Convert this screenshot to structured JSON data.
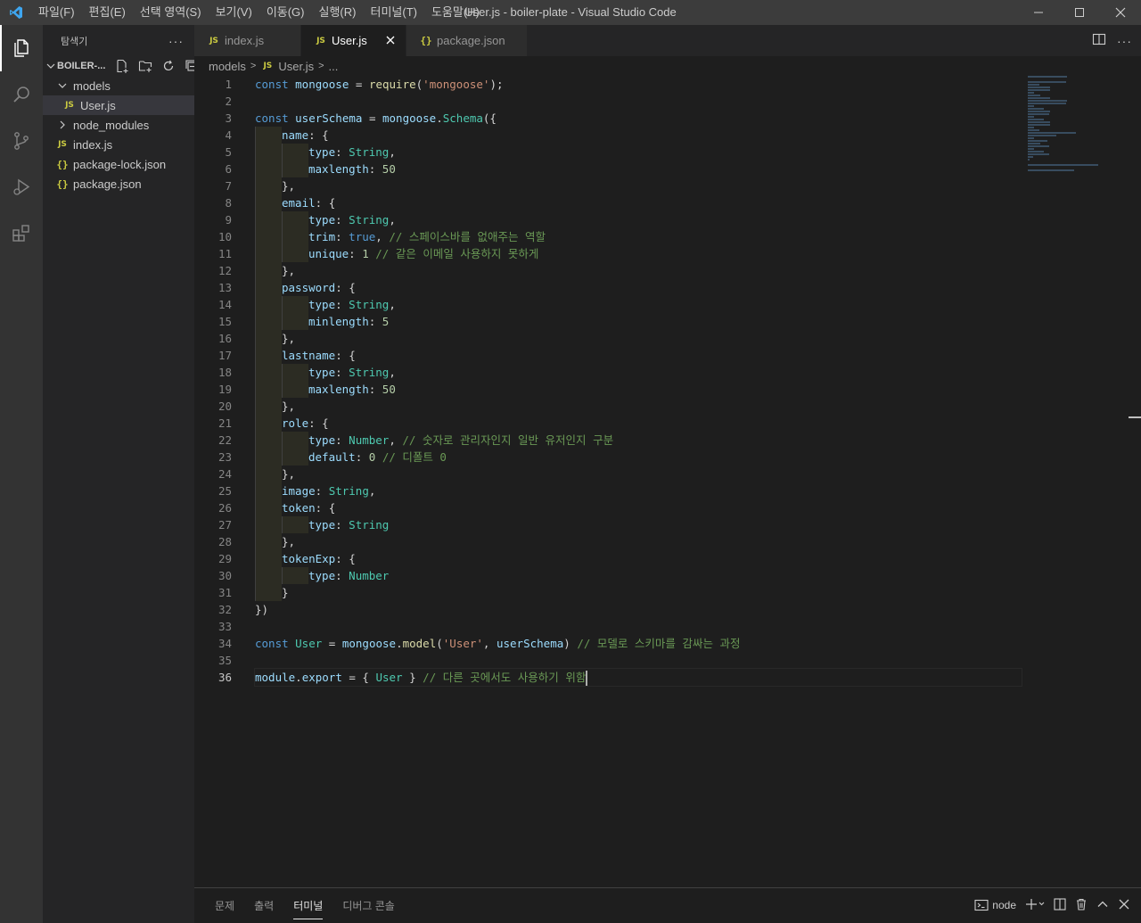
{
  "window": {
    "title": "User.js - boiler-plate - Visual Studio Code",
    "menu": [
      "파일(F)",
      "편집(E)",
      "선택 영역(S)",
      "보기(V)",
      "이동(G)",
      "실행(R)",
      "터미널(T)",
      "도움말(H)"
    ]
  },
  "sidebar": {
    "title": "탐색기",
    "more": "···",
    "folder": "BOILER-...",
    "tree": [
      {
        "label": "models",
        "kind": "folder-open",
        "depth": 1
      },
      {
        "label": "User.js",
        "kind": "js",
        "depth": 2,
        "selected": true
      },
      {
        "label": "node_modules",
        "kind": "folder-closed",
        "depth": 1
      },
      {
        "label": "index.js",
        "kind": "js",
        "depth": 1
      },
      {
        "label": "package-lock.json",
        "kind": "json",
        "depth": 1
      },
      {
        "label": "package.json",
        "kind": "json",
        "depth": 1
      }
    ]
  },
  "tabs": [
    {
      "label": "index.js",
      "icon": "JS",
      "active": false
    },
    {
      "label": "User.js",
      "icon": "JS",
      "active": true
    },
    {
      "label": "package.json",
      "icon": "{}",
      "active": false
    }
  ],
  "breadcrumb": {
    "folder": "models",
    "file": "User.js",
    "symbol": "..."
  },
  "editor": {
    "active_line": 36,
    "lines": [
      [
        {
          "t": "const ",
          "c": "kw"
        },
        {
          "t": "mongoose",
          "c": "var"
        },
        {
          "t": " = ",
          "c": "plain"
        },
        {
          "t": "require",
          "c": "fn"
        },
        {
          "t": "(",
          "c": "plain"
        },
        {
          "t": "'mongoose'",
          "c": "str"
        },
        {
          "t": ");",
          "c": "plain"
        }
      ],
      [],
      [
        {
          "t": "const ",
          "c": "kw"
        },
        {
          "t": "userSchema",
          "c": "var"
        },
        {
          "t": " = ",
          "c": "plain"
        },
        {
          "t": "mongoose",
          "c": "var"
        },
        {
          "t": ".",
          "c": "plain"
        },
        {
          "t": "Schema",
          "c": "cls"
        },
        {
          "t": "({",
          "c": "plain"
        }
      ],
      [
        {
          "i": 1
        },
        {
          "t": "name",
          "c": "var"
        },
        {
          "t": ": {",
          "c": "plain"
        }
      ],
      [
        {
          "i": 2
        },
        {
          "t": "type",
          "c": "var"
        },
        {
          "t": ": ",
          "c": "plain"
        },
        {
          "t": "String",
          "c": "cls"
        },
        {
          "t": ",",
          "c": "plain"
        }
      ],
      [
        {
          "i": 2
        },
        {
          "t": "maxlength",
          "c": "var"
        },
        {
          "t": ": ",
          "c": "plain"
        },
        {
          "t": "50",
          "c": "num"
        }
      ],
      [
        {
          "i": 1
        },
        {
          "t": "},",
          "c": "plain"
        }
      ],
      [
        {
          "i": 1
        },
        {
          "t": "email",
          "c": "var"
        },
        {
          "t": ": {",
          "c": "plain"
        }
      ],
      [
        {
          "i": 2
        },
        {
          "t": "type",
          "c": "var"
        },
        {
          "t": ": ",
          "c": "plain"
        },
        {
          "t": "String",
          "c": "cls"
        },
        {
          "t": ",",
          "c": "plain"
        }
      ],
      [
        {
          "i": 2
        },
        {
          "t": "trim",
          "c": "var"
        },
        {
          "t": ": ",
          "c": "plain"
        },
        {
          "t": "true",
          "c": "kw"
        },
        {
          "t": ", ",
          "c": "plain"
        },
        {
          "t": "// 스페이스바를 없애주는 역할",
          "c": "cmt"
        }
      ],
      [
        {
          "i": 2
        },
        {
          "t": "unique",
          "c": "var"
        },
        {
          "t": ": ",
          "c": "plain"
        },
        {
          "t": "1",
          "c": "num"
        },
        {
          "t": " ",
          "c": "plain"
        },
        {
          "t": "// 같은 이메일 사용하지 못하게",
          "c": "cmt"
        }
      ],
      [
        {
          "i": 1
        },
        {
          "t": "},",
          "c": "plain"
        }
      ],
      [
        {
          "i": 1
        },
        {
          "t": "password",
          "c": "var"
        },
        {
          "t": ": {",
          "c": "plain"
        }
      ],
      [
        {
          "i": 2
        },
        {
          "t": "type",
          "c": "var"
        },
        {
          "t": ": ",
          "c": "plain"
        },
        {
          "t": "String",
          "c": "cls"
        },
        {
          "t": ",",
          "c": "plain"
        }
      ],
      [
        {
          "i": 2
        },
        {
          "t": "minlength",
          "c": "var"
        },
        {
          "t": ": ",
          "c": "plain"
        },
        {
          "t": "5",
          "c": "num"
        }
      ],
      [
        {
          "i": 1
        },
        {
          "t": "},",
          "c": "plain"
        }
      ],
      [
        {
          "i": 1
        },
        {
          "t": "lastname",
          "c": "var"
        },
        {
          "t": ": {",
          "c": "plain"
        }
      ],
      [
        {
          "i": 2
        },
        {
          "t": "type",
          "c": "var"
        },
        {
          "t": ": ",
          "c": "plain"
        },
        {
          "t": "String",
          "c": "cls"
        },
        {
          "t": ",",
          "c": "plain"
        }
      ],
      [
        {
          "i": 2
        },
        {
          "t": "maxlength",
          "c": "var"
        },
        {
          "t": ": ",
          "c": "plain"
        },
        {
          "t": "50",
          "c": "num"
        }
      ],
      [
        {
          "i": 1
        },
        {
          "t": "},",
          "c": "plain"
        }
      ],
      [
        {
          "i": 1
        },
        {
          "t": "role",
          "c": "var"
        },
        {
          "t": ": {",
          "c": "plain"
        }
      ],
      [
        {
          "i": 2
        },
        {
          "t": "type",
          "c": "var"
        },
        {
          "t": ": ",
          "c": "plain"
        },
        {
          "t": "Number",
          "c": "cls"
        },
        {
          "t": ", ",
          "c": "plain"
        },
        {
          "t": "// 숫자로 관리자인지 일반 유저인지 구분",
          "c": "cmt"
        }
      ],
      [
        {
          "i": 2
        },
        {
          "t": "default",
          "c": "var"
        },
        {
          "t": ": ",
          "c": "plain"
        },
        {
          "t": "0",
          "c": "num"
        },
        {
          "t": " ",
          "c": "plain"
        },
        {
          "t": "// 디폴트 0",
          "c": "cmt"
        }
      ],
      [
        {
          "i": 1
        },
        {
          "t": "},",
          "c": "plain"
        }
      ],
      [
        {
          "i": 1
        },
        {
          "t": "image",
          "c": "var"
        },
        {
          "t": ": ",
          "c": "plain"
        },
        {
          "t": "String",
          "c": "cls"
        },
        {
          "t": ",",
          "c": "plain"
        }
      ],
      [
        {
          "i": 1
        },
        {
          "t": "token",
          "c": "var"
        },
        {
          "t": ": {",
          "c": "plain"
        }
      ],
      [
        {
          "i": 2
        },
        {
          "t": "type",
          "c": "var"
        },
        {
          "t": ": ",
          "c": "plain"
        },
        {
          "t": "String",
          "c": "cls"
        }
      ],
      [
        {
          "i": 1
        },
        {
          "t": "},",
          "c": "plain"
        }
      ],
      [
        {
          "i": 1
        },
        {
          "t": "tokenExp",
          "c": "var"
        },
        {
          "t": ": {",
          "c": "plain"
        }
      ],
      [
        {
          "i": 2
        },
        {
          "t": "type",
          "c": "var"
        },
        {
          "t": ": ",
          "c": "plain"
        },
        {
          "t": "Number",
          "c": "cls"
        }
      ],
      [
        {
          "i": 1
        },
        {
          "t": "}",
          "c": "plain"
        }
      ],
      [
        {
          "t": "})",
          "c": "plain"
        }
      ],
      [],
      [
        {
          "t": "const ",
          "c": "kw"
        },
        {
          "t": "User",
          "c": "cls"
        },
        {
          "t": " = ",
          "c": "plain"
        },
        {
          "t": "mongoose",
          "c": "var"
        },
        {
          "t": ".",
          "c": "plain"
        },
        {
          "t": "model",
          "c": "fn"
        },
        {
          "t": "(",
          "c": "plain"
        },
        {
          "t": "'User'",
          "c": "str"
        },
        {
          "t": ", ",
          "c": "plain"
        },
        {
          "t": "userSchema",
          "c": "var"
        },
        {
          "t": ") ",
          "c": "plain"
        },
        {
          "t": "// 모델로 스키마를 감싸는 과정",
          "c": "cmt"
        }
      ],
      [],
      [
        {
          "t": "module",
          "c": "var"
        },
        {
          "t": ".",
          "c": "plain"
        },
        {
          "t": "export",
          "c": "var"
        },
        {
          "t": " = { ",
          "c": "plain"
        },
        {
          "t": "User",
          "c": "cls"
        },
        {
          "t": " } ",
          "c": "plain"
        },
        {
          "t": "// 다른 곳에서도 사용하기 위함",
          "c": "cmt"
        }
      ]
    ]
  },
  "panel": {
    "tabs": [
      {
        "label": "문제",
        "active": false
      },
      {
        "label": "출력",
        "active": false
      },
      {
        "label": "터미널",
        "active": true
      },
      {
        "label": "디버그 콘솔",
        "active": false
      }
    ],
    "terminal": "node"
  },
  "colors": {
    "accent": "#007acc",
    "keyword": "#569cd6",
    "variable": "#9cdcfe",
    "class": "#4ec9b0",
    "function": "#dcdcaa",
    "string": "#ce9178",
    "number": "#b5cea8",
    "comment": "#6a9955",
    "js_icon": "#cbcb41"
  }
}
